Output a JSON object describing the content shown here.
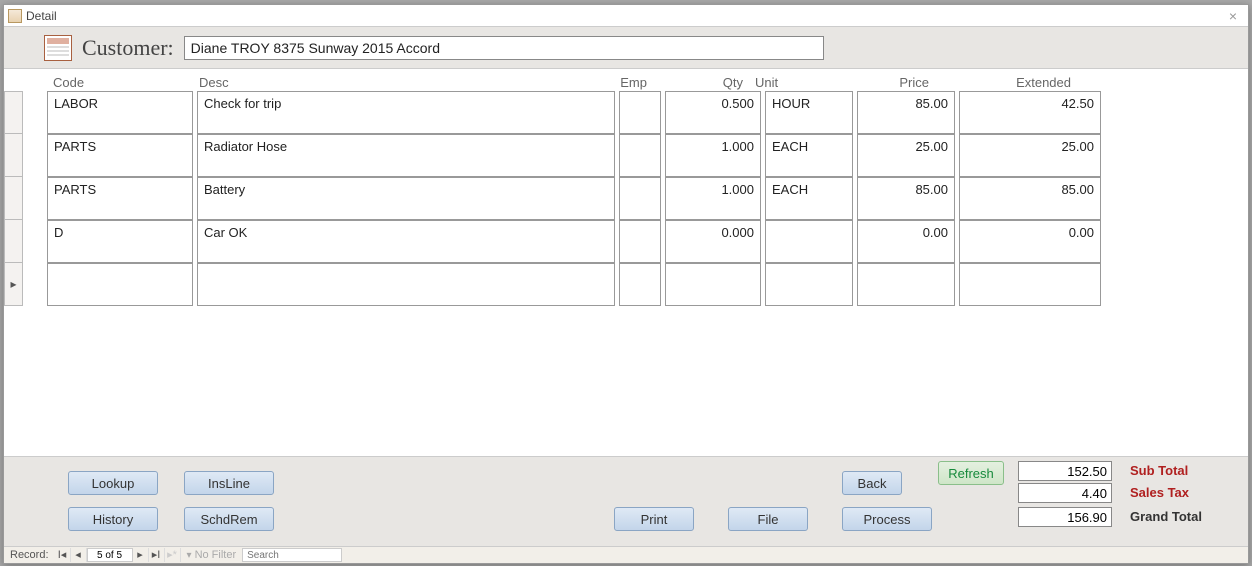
{
  "window": {
    "title": "Detail"
  },
  "header": {
    "customer_label": "Customer:",
    "customer_value": "Diane TROY 8375 Sunway 2015 Accord"
  },
  "columns": {
    "code": "Code",
    "desc": "Desc",
    "emp": "Emp",
    "qty": "Qty",
    "unit": "Unit",
    "price": "Price",
    "extended": "Extended"
  },
  "rows": [
    {
      "code": "LABOR",
      "desc": "Check for trip",
      "emp": "",
      "qty": "0.500",
      "unit": "HOUR",
      "price": "85.00",
      "ext": "42.50"
    },
    {
      "code": "PARTS",
      "desc": "Radiator Hose",
      "emp": "",
      "qty": "1.000",
      "unit": "EACH",
      "price": "25.00",
      "ext": "25.00"
    },
    {
      "code": "PARTS",
      "desc": "Battery",
      "emp": "",
      "qty": "1.000",
      "unit": "EACH",
      "price": "85.00",
      "ext": "85.00"
    },
    {
      "code": "D",
      "desc": "Car OK",
      "emp": "",
      "qty": "0.000",
      "unit": "",
      "price": "0.00",
      "ext": "0.00"
    },
    {
      "code": "",
      "desc": "",
      "emp": "",
      "qty": "",
      "unit": "",
      "price": "",
      "ext": ""
    }
  ],
  "buttons": {
    "lookup": "Lookup",
    "insline": "InsLine",
    "history": "History",
    "schdrem": "SchdRem",
    "print": "Print",
    "file": "File",
    "back": "Back",
    "process": "Process",
    "refresh": "Refresh"
  },
  "totals": {
    "subtotal": "152.50",
    "salestax": "4.40",
    "grandtotal": "156.90",
    "subtotal_label": "Sub Total",
    "salestax_label": "Sales Tax",
    "grandtotal_label": "Grand Total"
  },
  "status": {
    "record_label": "Record:",
    "record_pos": "5 of 5",
    "nofilter": "No Filter",
    "search_placeholder": "Search"
  }
}
